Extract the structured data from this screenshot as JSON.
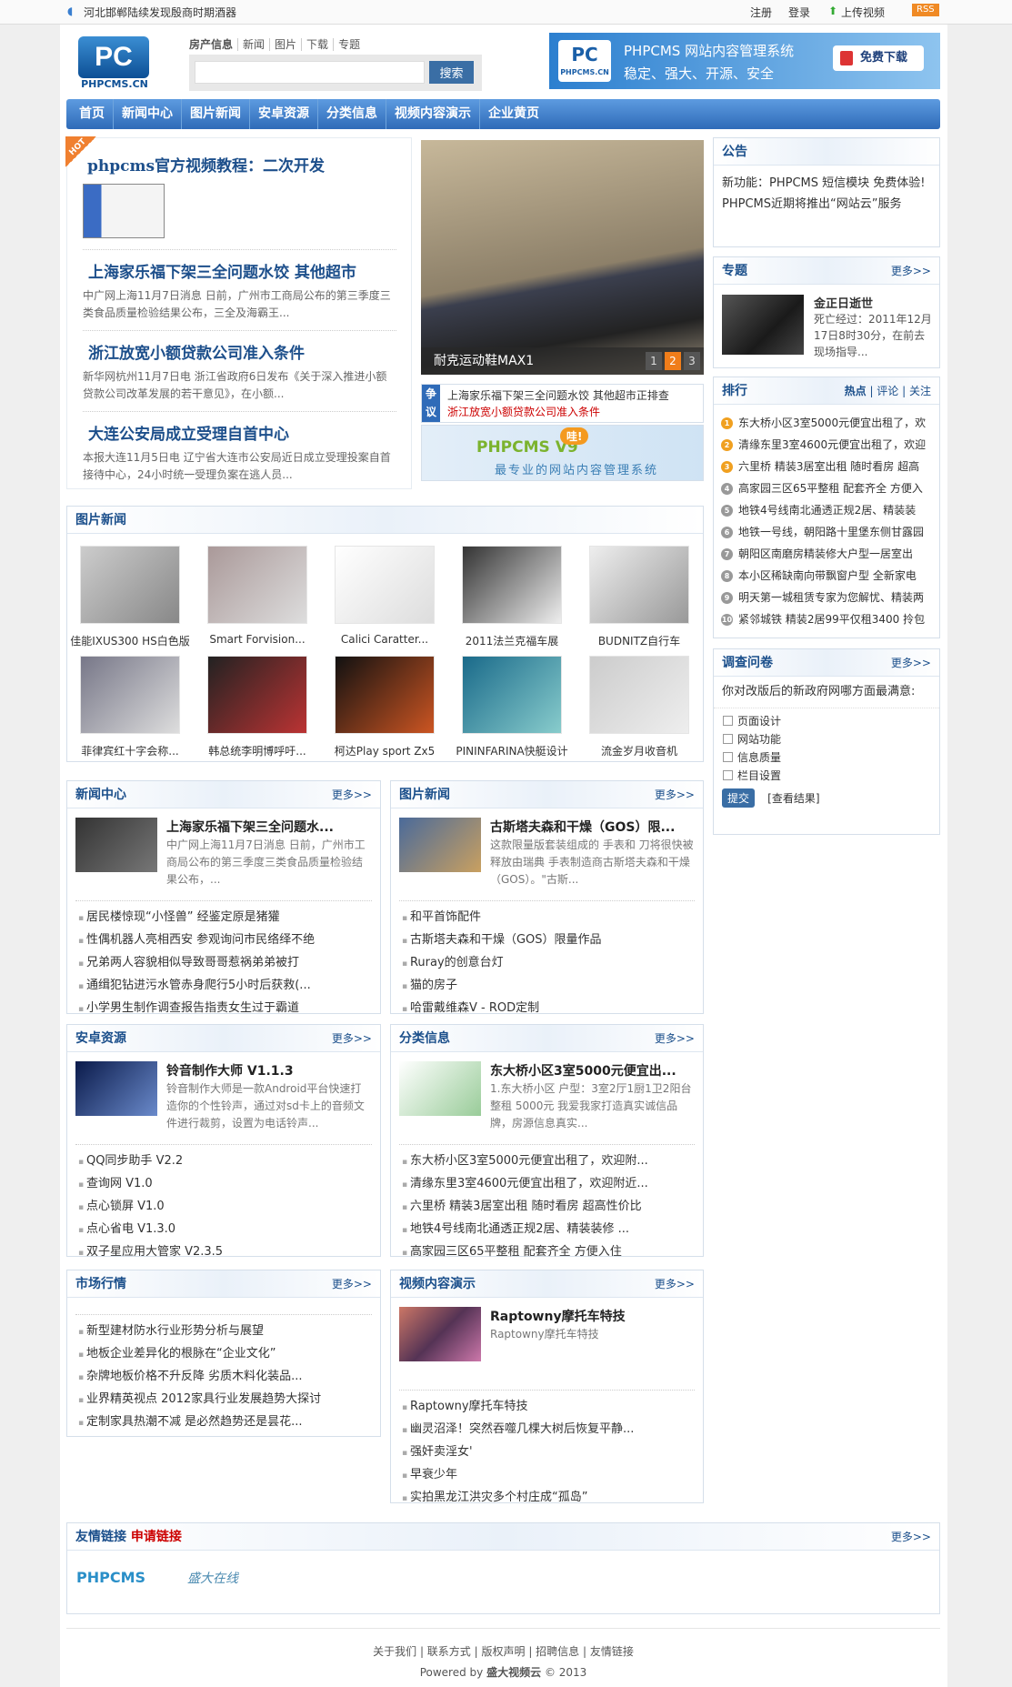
{
  "topbar": {
    "notice": "河北邯郸陆续发现殷商时期酒器",
    "register": "注册",
    "login": "登录",
    "upload": "上传视频",
    "rss": "RSS"
  },
  "header": {
    "logo_mark": "PC",
    "logo_text": "PHPCMS.CN",
    "search_tabs": [
      "房产信息",
      "新闻",
      "图片",
      "下载",
      "专题"
    ],
    "search_placeholder": "",
    "search_button": "搜索",
    "banner": {
      "logo_mark": "PC",
      "logo_text": "PHPCMS.CN",
      "title": "PHPCMS 网站内容管理系统",
      "slogan": "稳定、强大、开源、安全",
      "download": "免费下载"
    }
  },
  "nav": [
    "首页",
    "新闻中心",
    "图片新闻",
    "安卓资源",
    "分类信息",
    "视频内容演示",
    "企业黄页"
  ],
  "headline": {
    "hot": "HOT",
    "video_title": "phpcms官方视频教程：二次开发",
    "items": [
      {
        "title": "上海家乐福下架三全问题水饺 其他超市",
        "summary": "中广网上海11月7日消息 日前，广州市工商局公布的第三季度三类食品质量检验结果公布，三全及海霸王..."
      },
      {
        "title": "浙江放宽小额贷款公司准入条件",
        "summary": "新华网杭州11月7日电 浙江省政府6日发布《关于深入推进小额贷款公司改革发展的若干意见》，在小额..."
      },
      {
        "title": "大连公安局成立受理自首中心",
        "summary": "本报大连11月5日电 辽宁省大连市公安局近日成立受理投案自首接待中心，24小时统一受理负案在逃人员..."
      }
    ]
  },
  "slideshow": {
    "caption": "耐克运动鞋MAX1",
    "pages": [
      "1",
      "2",
      "3"
    ],
    "active": 2
  },
  "debate": {
    "badge": "争议",
    "line1": "上海家乐福下架三全问题水饺 其他超市正排查",
    "line2": "浙江放宽小额贷款公司准入条件"
  },
  "ad": {
    "title": "PHPCMS V9",
    "bubble": "哇!",
    "slogan": "最专业的网站内容管理系统"
  },
  "notice": {
    "title": "公告",
    "items": [
      "新功能：PHPCMS 短信模块 免费体验!",
      "PHPCMS近期将推出“网站云”服务"
    ]
  },
  "special": {
    "title": "专题",
    "more": "更多>>",
    "item_title": "金正日逝世",
    "summary": "死亡经过：2011年12月17日8时30分，在前去现场指导..."
  },
  "ranking": {
    "title": "排行",
    "tabs": [
      "热点",
      "评论",
      "关注"
    ],
    "items": [
      "东大桥小区3室5000元便宜出租了，欢",
      "清缘东里3室4600元便宜出租了，欢迎",
      "六里桥 精装3居室出租 随时看房 超高",
      "高家园三区65平整租 配套齐全 方便入",
      "地铁4号线南北通透正规2居、精装装",
      "地铁一号线，朝阳路十里堡东侧甘露园",
      "朝阳区南磨房精装修大户型一居室出",
      "本小区稀缺南向带飘窗户型 全新家电",
      "明天第一城租赁专家为您解忧、精装两",
      "紧邻城铁 精装2居99平仅租3400 拎包"
    ]
  },
  "survey": {
    "title": "调查问卷",
    "more": "更多>>",
    "question": "你对改版后的新政府网哪方面最满意:",
    "options": [
      "页面设计",
      "网站功能",
      "信息质量",
      "栏目设置"
    ],
    "submit": "提交",
    "results": "[查看结果]"
  },
  "photo_news": {
    "title": "图片新闻",
    "items": [
      "佳能IXUS300 HS白色版",
      "Smart Forvision...",
      "Calici Caratter...",
      "2011法兰克福车展",
      "BUDNITZ自行车",
      "菲律宾红十字会称...",
      "韩总统李明博呼吁...",
      "柯达Play sport Zx5",
      "PININFARINA快艇设计",
      "流金岁月收音机"
    ]
  },
  "sections": [
    {
      "title": "新闻中心",
      "more": "更多>>",
      "feature_title": "上海家乐福下架三全问题水...",
      "feature_summary": "中广网上海11月7日消息 日前，广州市工商局公布的第三季度三类食品质量检验结果公布，...",
      "items": [
        "居民楼惊现“小怪兽” 经鉴定原是猪獾",
        "性偶机器人亮相西安 参观询问市民络绎不绝",
        "兄弟两人容貌相似导致哥哥惹祸弟弟被打",
        "通缉犯钻进污水管赤身爬行5小时后获救(...",
        "小学男生制作调查报告指责女生过于霸道"
      ]
    },
    {
      "title": "图片新闻",
      "more": "更多>>",
      "feature_title": "古斯塔夫森和干燥（GOS）限...",
      "feature_summary": "这款限量版套装组成的 手表和 刀将很快被释放由瑞典 手表制造商古斯塔夫森和干燥（GOS）。\"古斯...",
      "items": [
        "和平首饰配件",
        "古斯塔夫森和干燥（GOS）限量作品",
        "Ruray的创意台灯",
        "猫的房子",
        "哈雷戴维森V - ROD定制"
      ]
    },
    {
      "title": "安卓资源",
      "more": "更多>>",
      "feature_title": "铃音制作大师 V1.1.3",
      "feature_summary": "铃音制作大师是一款Android平台快速打造你的个性铃声，通过对sd卡上的音频文件进行裁剪，设置为电话铃声...",
      "items": [
        "QQ同步助手 V2.2",
        "查询网 V1.0",
        "点心锁屏 V1.0",
        "点心省电 V1.3.0",
        "双子星应用大管家 V2.3.5"
      ]
    },
    {
      "title": "分类信息",
      "more": "更多>>",
      "feature_title": "东大桥小区3室5000元便宜出...",
      "feature_summary": "1.东大桥小区 户型：3室2厅1厨1卫2阳台 整租 5000元 我爱我家打造真实诚信品牌，房源信息真实...",
      "items": [
        "东大桥小区3室5000元便宜出租了，欢迎附...",
        "清缘东里3室4600元便宜出租了，欢迎附近...",
        "六里桥 精装3居室出租 随时看房 超高性价比",
        "地铁4号线南北通透正规2居、精装装修 ...",
        "高家园三区65平整租 配套齐全 方便入住"
      ]
    },
    {
      "title": "市场行情",
      "more": "更多>>",
      "items": [
        "新型建材防水行业形势分析与展望",
        "地板企业差异化的根脉在“企业文化”",
        "杂牌地板价格不升反降 劣质木料化装品...",
        "业界精英视点 2012家具行业发展趋势大探讨",
        "定制家具热潮不减 是必然趋势还是昙花..."
      ]
    },
    {
      "title": "视频内容演示",
      "more": "更多>>",
      "feature_title": "Raptowny摩托车特技",
      "feature_summary": "Raptowny摩托车特技",
      "items": [
        "Raptowny摩托车特技",
        "幽灵沼泽！突然吞噬几棵大树后恢复平静...",
        "强奸卖淫女'",
        "早衰少年",
        "实拍黑龙江洪灾多个村庄成“孤岛”"
      ]
    }
  ],
  "links": {
    "title": "友情链接",
    "apply": "申请链接",
    "more": "更多>>",
    "logos": [
      "PHPCMS",
      "盛大在线"
    ]
  },
  "footer": {
    "links": [
      "关于我们",
      "联系方式",
      "版权声明",
      "招聘信息",
      "友情链接"
    ],
    "powered_prefix": "Powered by",
    "powered_brand": "盛大视频云",
    "powered_suffix": "© 2013"
  }
}
